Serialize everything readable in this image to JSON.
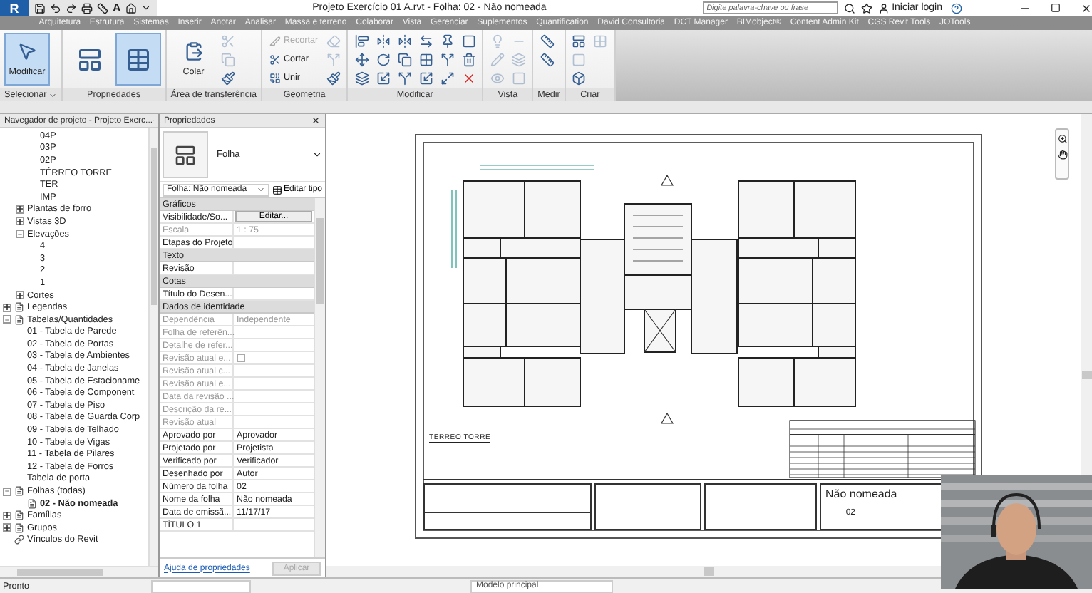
{
  "title_bar": {
    "app_logo": "R",
    "text_tool": "A",
    "title": "Projeto Exercício 01 A.rvt - Folha: 02 - Não nomeada",
    "search": {
      "placeholder": "Digite palavra-chave ou frase"
    },
    "login": "Iniciar login"
  },
  "ribbon_tabs": [
    {
      "label": "Arquitetura",
      "selected": false
    },
    {
      "label": "Estrutura",
      "selected": false
    },
    {
      "label": "Sistemas",
      "selected": false
    },
    {
      "label": "Inserir",
      "selected": false
    },
    {
      "label": "Anotar",
      "selected": false
    },
    {
      "label": "Analisar",
      "selected": false
    },
    {
      "label": "Massa e terreno",
      "selected": false
    },
    {
      "label": "Colaborar",
      "selected": false
    },
    {
      "label": "Vista",
      "selected": false
    },
    {
      "label": "Gerenciar",
      "selected": false
    },
    {
      "label": "Suplementos",
      "selected": false
    },
    {
      "label": "Quantification",
      "selected": false
    },
    {
      "label": "David Consultoria",
      "selected": false
    },
    {
      "label": "DCT Manager",
      "selected": false
    },
    {
      "label": "BIMobject®",
      "selected": false
    },
    {
      "label": "Content Admin Kit",
      "selected": false
    },
    {
      "label": "CGS Revit Tools",
      "selected": false
    },
    {
      "label": "JOTools",
      "selected": false
    }
  ],
  "ribbon_panels": [
    {
      "title": "Selecionar",
      "menu": true,
      "tools": [
        {
          "kind": "large",
          "label": "Modificar",
          "selected": true,
          "disabled": false
        }
      ]
    },
    {
      "title": "Propriedades",
      "tools": [
        {
          "kind": "large",
          "selected": false,
          "disabled": false
        },
        {
          "kind": "large",
          "selected": true,
          "disabled": false
        }
      ]
    },
    {
      "title": "Área de transferência",
      "tools": [
        {
          "kind": "large",
          "label": "Colar",
          "selected": false,
          "disabled": false
        },
        {
          "kind": "icon",
          "selected": false,
          "disabled": true
        },
        {
          "kind": "icon",
          "selected": false,
          "disabled": true
        },
        {
          "kind": "icon",
          "selected": false,
          "disabled": false
        }
      ]
    },
    {
      "title": "Geometria",
      "tools": [
        {
          "kind": "small",
          "label": "Recortar",
          "selected": false,
          "disabled": true
        },
        {
          "kind": "small",
          "label": "Cortar",
          "selected": false,
          "disabled": false
        },
        {
          "kind": "small",
          "label": "Unir",
          "selected": false,
          "disabled": false
        },
        {
          "kind": "icon",
          "selected": false,
          "disabled": true
        },
        {
          "kind": "icon",
          "selected": false,
          "disabled": true
        },
        {
          "kind": "icon",
          "selected": false,
          "disabled": false
        }
      ]
    },
    {
      "title": "Modificar",
      "tools": [
        {
          "kind": "icon",
          "selected": false,
          "disabled": false
        },
        {
          "kind": "icon",
          "selected": false,
          "disabled": false
        },
        {
          "kind": "icon",
          "selected": false,
          "disabled": false
        },
        {
          "kind": "icon",
          "selected": false,
          "disabled": false
        },
        {
          "kind": "icon",
          "selected": false,
          "disabled": false
        },
        {
          "kind": "icon",
          "selected": false,
          "disabled": false
        },
        {
          "kind": "icon",
          "selected": false,
          "disabled": false
        },
        {
          "kind": "icon",
          "selected": false,
          "disabled": false
        },
        {
          "kind": "icon",
          "selected": false,
          "disabled": false
        },
        {
          "kind": "icon",
          "selected": false,
          "disabled": false
        },
        {
          "kind": "icon",
          "selected": false,
          "disabled": false
        },
        {
          "kind": "icon",
          "selected": false,
          "disabled": false
        },
        {
          "kind": "icon",
          "selected": false,
          "disabled": false
        },
        {
          "kind": "icon",
          "selected": false,
          "disabled": false
        },
        {
          "kind": "icon",
          "selected": false,
          "disabled": false
        },
        {
          "kind": "icon",
          "selected": false,
          "disabled": false
        },
        {
          "kind": "icon",
          "selected": false,
          "disabled": false
        },
        {
          "kind": "icon",
          "selected": false,
          "disabled": false
        }
      ]
    },
    {
      "title": "Vista",
      "tools": [
        {
          "kind": "icon",
          "selected": false,
          "disabled": true
        },
        {
          "kind": "icon",
          "selected": false,
          "disabled": true
        },
        {
          "kind": "icon",
          "selected": false,
          "disabled": true
        },
        {
          "kind": "icon",
          "selected": false,
          "disabled": true
        },
        {
          "kind": "icon",
          "selected": false,
          "disabled": true
        },
        {
          "kind": "icon",
          "selected": false,
          "disabled": true
        }
      ]
    },
    {
      "title": "Medir",
      "tools": [
        {
          "kind": "icon",
          "selected": false,
          "disabled": false
        },
        {
          "kind": "icon",
          "selected": false,
          "disabled": false
        }
      ]
    },
    {
      "title": "Criar",
      "tools": [
        {
          "kind": "icon",
          "selected": false,
          "disabled": false
        },
        {
          "kind": "icon",
          "selected": false,
          "disabled": true
        },
        {
          "kind": "icon",
          "selected": false,
          "disabled": false
        },
        {
          "kind": "icon",
          "selected": false,
          "disabled": true
        }
      ]
    }
  ],
  "project_browser": {
    "title": "Navegador de projeto - Projeto Exerc...",
    "tree": [
      {
        "children": [
          {
            "children": [
              {
                "label": "04P",
                "bold": false
              },
              {
                "label": "03P",
                "bold": false
              },
              {
                "label": "02P",
                "bold": false
              },
              {
                "label": "TÉRREO TORRE",
                "bold": false
              },
              {
                "label": "TER",
                "bold": false
              },
              {
                "label": "IMP",
                "bold": false
              }
            ]
          },
          {
            "label": "Plantas de forro",
            "expanded": false,
            "bold": false
          },
          {
            "label": "Vistas 3D",
            "expanded": false,
            "bold": false
          },
          {
            "label": "Elevações",
            "expanded": true,
            "bold": false,
            "children": [
              {
                "label": "4",
                "bold": false
              },
              {
                "label": "3",
                "bold": false
              },
              {
                "label": "2",
                "bold": false
              },
              {
                "label": "1",
                "bold": false
              }
            ]
          },
          {
            "label": "Cortes",
            "expanded": false,
            "bold": false
          }
        ]
      },
      {
        "label": "Legendas",
        "kind": "category",
        "expanded": false,
        "bold": false
      },
      {
        "label": "Tabelas/Quantidades",
        "kind": "category",
        "expanded": true,
        "bold": false,
        "children": [
          {
            "label": "01 - Tabela de Parede",
            "bold": false
          },
          {
            "label": "02 - Tabela de Portas",
            "bold": false
          },
          {
            "label": "03 - Tabela de Ambientes",
            "bold": false
          },
          {
            "label": "04 - Tabela de Janelas",
            "bold": false
          },
          {
            "label": "05 - Tabela de Estacioname",
            "bold": false
          },
          {
            "label": "06 - Tabela de Component",
            "bold": false
          },
          {
            "label": "07 - Tabela de Piso",
            "bold": false
          },
          {
            "label": "08 - Tabela de Guarda Corp",
            "bold": false
          },
          {
            "label": "09 - Tabela de Telhado",
            "bold": false
          },
          {
            "label": "10 - Tabela de Vigas",
            "bold": false
          },
          {
            "label": "11 - Tabela de Pilares",
            "bold": false
          },
          {
            "label": "12 - Tabela de Forros",
            "bold": false
          },
          {
            "label": "Tabela de porta",
            "bold": false
          }
        ]
      },
      {
        "label": "Folhas (todas)",
        "kind": "category",
        "expanded": true,
        "bold": false,
        "children": [
          {
            "label": "02 - Não nomeada",
            "kind": "sheet",
            "bold": true
          }
        ]
      },
      {
        "label": "Famílias",
        "kind": "category",
        "expanded": false,
        "bold": false
      },
      {
        "label": "Grupos",
        "kind": "category",
        "expanded": false,
        "bold": false
      },
      {
        "label": "Vínculos do Revit",
        "kind": "link",
        "bold": false
      }
    ]
  },
  "properties": {
    "title": "Propriedades",
    "type_name": "Folha",
    "instance": "Folha: Não nomeada",
    "edit_type": "Editar tipo",
    "groups": [
      {
        "title": "Gráficos",
        "rows": [
          {
            "label": "Visibilidade/So...",
            "value": "Editar...",
            "kind": "button",
            "disabled": false
          },
          {
            "label": "Escala",
            "value": "1 : 75",
            "kind": "text",
            "disabled": true
          },
          {
            "label": "Etapas do Projeto",
            "kind": "text",
            "disabled": false
          }
        ]
      },
      {
        "title": "Texto",
        "rows": [
          {
            "label": "Revisão",
            "kind": "text",
            "disabled": false
          }
        ]
      },
      {
        "title": "Cotas",
        "rows": [
          {
            "label": "Título do Desen...",
            "kind": "text",
            "disabled": false
          }
        ]
      },
      {
        "title": "Dados de identidade",
        "rows": [
          {
            "label": "Dependência",
            "value": "Independente",
            "kind": "text",
            "disabled": true
          },
          {
            "label": "Folha de referên...",
            "kind": "text",
            "disabled": true
          },
          {
            "label": "Detalhe de refer...",
            "kind": "text",
            "disabled": true
          },
          {
            "label": "Revisão atual e...",
            "kind": "checkbox",
            "checked": false,
            "disabled": true
          },
          {
            "label": "Revisão atual c...",
            "kind": "text",
            "disabled": true
          },
          {
            "label": "Revisão atual e...",
            "kind": "text",
            "disabled": true
          },
          {
            "label": "Data da revisão ...",
            "kind": "text",
            "disabled": true
          },
          {
            "label": "Descrição da re...",
            "kind": "text",
            "disabled": true
          },
          {
            "label": "Revisão atual",
            "kind": "text",
            "disabled": true
          },
          {
            "label": "Aprovado por",
            "value": "Aprovador",
            "kind": "text",
            "disabled": false
          },
          {
            "label": "Projetado por",
            "value": "Projetista",
            "kind": "text",
            "disabled": false
          },
          {
            "label": "Verificado por",
            "value": "Verificador",
            "kind": "text",
            "disabled": false
          },
          {
            "label": "Desenhado por",
            "value": "Autor",
            "kind": "text",
            "disabled": false
          },
          {
            "label": "Número da folha",
            "value": "02",
            "kind": "text",
            "disabled": false
          },
          {
            "label": "Nome da folha",
            "value": "Não nomeada",
            "kind": "text",
            "disabled": false
          },
          {
            "label": "Data de emissã...",
            "value": "11/17/17",
            "kind": "text",
            "disabled": false
          },
          {
            "label": "TÍTULO 1",
            "kind": "text",
            "disabled": false
          }
        ]
      }
    ],
    "help": "Ajuda de propriedades",
    "apply": {
      "label": "Aplicar",
      "disabled": true
    }
  },
  "sheet": {
    "view_title": "TERREO TORRE",
    "sheet_name": "Não nomeada",
    "sheet_number": "02"
  },
  "status_bar": {
    "status": "Pronto",
    "model": "Modelo principal"
  }
}
